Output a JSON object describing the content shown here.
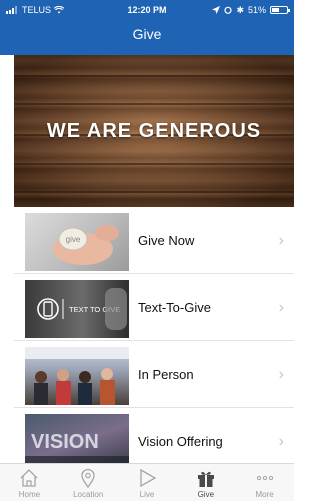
{
  "status_bar": {
    "carrier": "TELUS",
    "time": "12:20 PM",
    "battery_percent": "51%",
    "battery_level": 0.51
  },
  "header": {
    "title": "Give"
  },
  "hero": {
    "text": "WE ARE GENEROUS"
  },
  "thumb_texts": {
    "text_to_give": "TEXT TO GIVE",
    "give_card": "give",
    "vision": "VISION"
  },
  "items": [
    {
      "label": "Give Now",
      "thumb": "hands-holding-give-card"
    },
    {
      "label": "Text-To-Give",
      "thumb": "phone-text-to-give"
    },
    {
      "label": "In Person",
      "thumb": "crowd-photo"
    },
    {
      "label": "Vision Offering",
      "thumb": "vision-photo"
    }
  ],
  "tabs": [
    {
      "label": "Home",
      "icon": "home-icon"
    },
    {
      "label": "Location",
      "icon": "location-pin-icon"
    },
    {
      "label": "Live",
      "icon": "play-icon"
    },
    {
      "label": "Give",
      "icon": "gift-icon",
      "active": true
    },
    {
      "label": "More",
      "icon": "more-dots-icon"
    }
  ],
  "colors": {
    "header": "#1f64b4",
    "tab_active": "#4a4a4a",
    "tab_inactive": "#9a9a9a"
  }
}
